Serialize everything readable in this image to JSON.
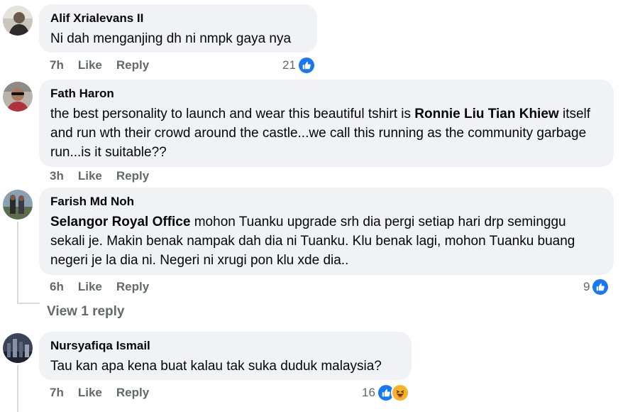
{
  "comments": [
    {
      "author": "Alif Xrialevans II",
      "text": "Ni dah menganjing dh ni nmpk gaya nya",
      "time": "7h",
      "like": "Like",
      "reply": "Reply",
      "reactions": "21"
    },
    {
      "author": "Fath Haron",
      "text_a": "the best personality to launch and wear this beautiful tshirt is ",
      "mention": "Ronnie Liu Tian Khiew",
      "text_b": " itself and run wth their crowd around the castle...we call this running as the community garbage run...is it suitable??",
      "time": "3h",
      "like": "Like",
      "reply": "Reply"
    },
    {
      "author": "Farish Md Noh",
      "mention": "Selangor Royal Office",
      "text_b": " mohon Tuanku upgrade srh dia pergi setiap hari drp seminggu sekali je. Makin benak nampak dah dia ni Tuanku. Klu benak lagi, mohon Tuanku buang negeri je la dia ni. Negeri ni xrugi pon klu xde dia..",
      "time": "6h",
      "like": "Like",
      "reply": "Reply",
      "reactions": "9",
      "view_replies": "View 1 reply"
    },
    {
      "author": "Nursyafiqa Ismail",
      "text": "Tau kan apa kena buat kalau tak suka duduk malaysia?",
      "time": "7h",
      "like": "Like",
      "reply": "Reply",
      "reactions": "16"
    }
  ],
  "colors": {
    "bubble": "#f0f2f5",
    "meta": "#65676b",
    "like_blue": "#1877f2",
    "haha_yellow": "#f7b125"
  },
  "icons": [
    "like-reaction-icon",
    "haha-reaction-icon"
  ]
}
